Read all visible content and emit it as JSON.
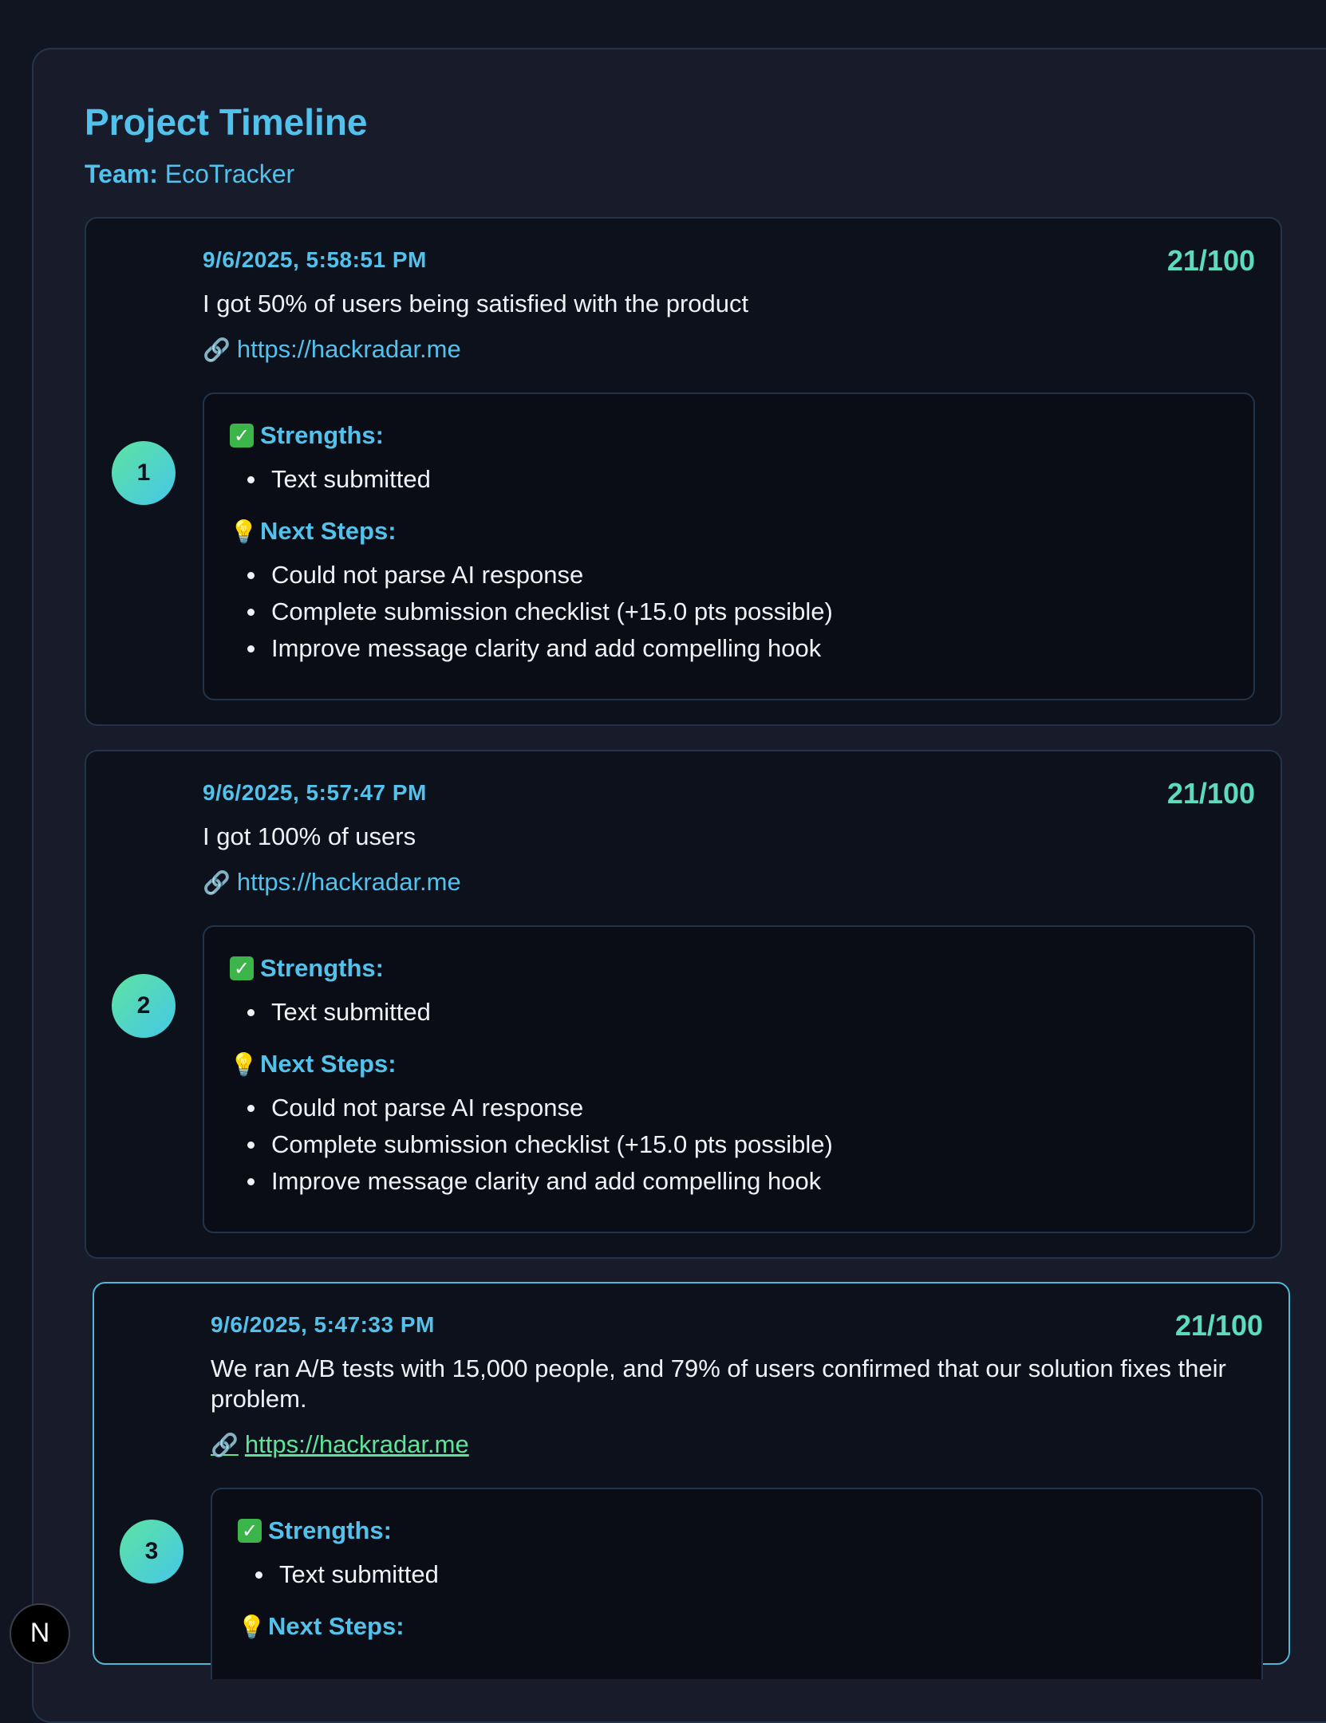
{
  "header": {
    "title": "Project Timeline",
    "team_label": "Team:",
    "team_name": "EcoTracker"
  },
  "entries": [
    {
      "index": "1",
      "timestamp": "9/6/2025, 5:58:51 PM",
      "score": "21/100",
      "message": "I got 50% of users being satisfied with the product",
      "link": "https://hackradar.me",
      "strengths_label": "Strengths:",
      "strengths": [
        "Text submitted"
      ],
      "next_steps_label": "Next Steps:",
      "next_steps": [
        "Could not parse AI response",
        "Complete submission checklist (+15.0 pts possible)",
        "Improve message clarity and add compelling hook"
      ]
    },
    {
      "index": "2",
      "timestamp": "9/6/2025, 5:57:47 PM",
      "score": "21/100",
      "message": "I got 100% of users",
      "link": "https://hackradar.me",
      "strengths_label": "Strengths:",
      "strengths": [
        "Text submitted"
      ],
      "next_steps_label": "Next Steps:",
      "next_steps": [
        "Could not parse AI response",
        "Complete submission checklist (+15.0 pts possible)",
        "Improve message clarity and add compelling hook"
      ]
    },
    {
      "index": "3",
      "timestamp": "9/6/2025, 5:47:33 PM",
      "score": "21/100",
      "message": "We ran A/B tests with 15,000 people, and 79% of users confirmed that our solution fixes their problem.",
      "link": "https://hackradar.me",
      "strengths_label": "Strengths:",
      "strengths": [
        "Text submitted"
      ],
      "next_steps_label": "Next Steps:",
      "next_steps": []
    }
  ],
  "icons": {
    "link": "link-icon",
    "check": "check-icon",
    "bulb": "lightbulb-icon"
  },
  "corner_logo": "N",
  "colors": {
    "accent": "#52c2ec",
    "score": "#5cdcbc",
    "visited_link": "#5fe39a"
  }
}
